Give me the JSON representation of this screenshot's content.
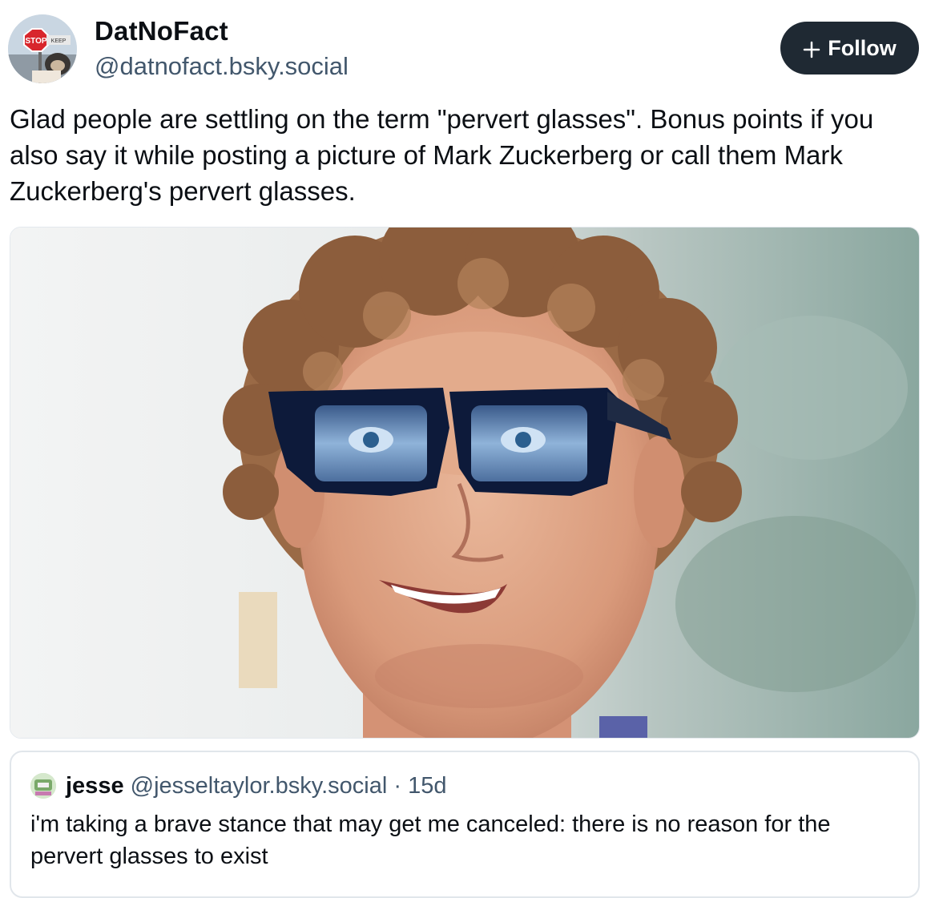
{
  "author": {
    "display_name": "DatNoFact",
    "handle": "@datnofact.bsky.social",
    "avatar_sign_text": "STOP",
    "avatar_small_text": "KEEP"
  },
  "follow_button": {
    "label": "Follow",
    "icon": "plus-icon"
  },
  "post": {
    "text": "Glad people are settling on the term \"pervert glasses\". Bonus points if you also say it while posting a picture of Mark Zuckerberg or call them Mark Zuckerberg's pervert glasses.",
    "image": {
      "subject": "photo-man-curly-hair-dark-glasses"
    }
  },
  "quote": {
    "display_name": "jesse",
    "handle": "@jesseltaylor.bsky.social",
    "separator": "·",
    "age": "15d",
    "text": "i'm taking a brave stance that may get me canceled: there is no reason for the pervert glasses to exist"
  },
  "colors": {
    "text_primary": "#0b0f14",
    "text_secondary": "#42576c",
    "follow_bg": "#1f2933",
    "border": "#e1e6eb"
  }
}
